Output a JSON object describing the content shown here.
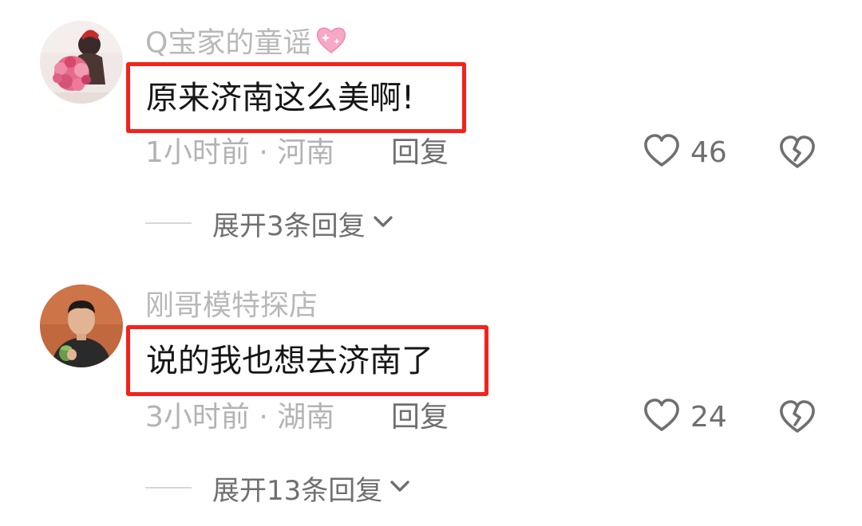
{
  "comments": [
    {
      "username": "Q宝家的童谣",
      "username_emoji": "sparkling-heart",
      "text": "原来济南这么美啊!",
      "time_location": "1小时前 · 河南",
      "reply_label": "回复",
      "like_count": "46",
      "expand_label": "展开3条回复"
    },
    {
      "username": "刚哥模特探店",
      "text": "说的我也想去济南了",
      "time_location": "3小时前 · 湖南",
      "reply_label": "回复",
      "like_count": "24",
      "expand_label": "展开13条回复"
    }
  ],
  "colors": {
    "highlight_box": "#f4221c",
    "username": "#b8b8b8",
    "meta": "#b3b3b3",
    "action": "#6f6f6f",
    "text": "#161616"
  },
  "icons": {
    "like": "heart-outline-icon",
    "dislike": "broken-heart-icon",
    "expand": "chevron-down-icon"
  }
}
